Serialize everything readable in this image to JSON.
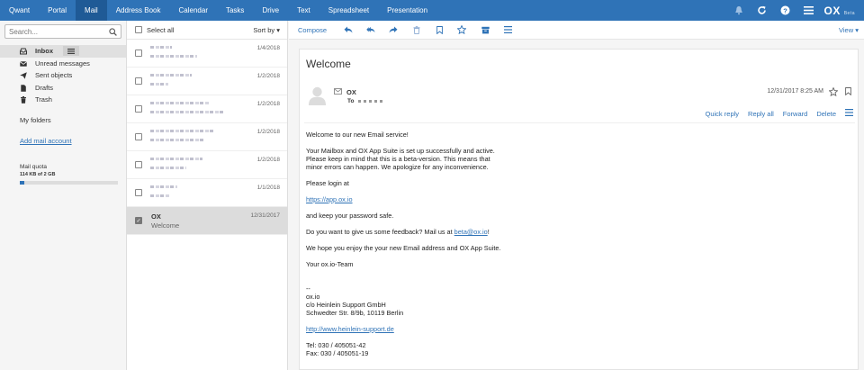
{
  "topnav": {
    "apps": [
      "Qwant",
      "Portal",
      "Mail",
      "Address Book",
      "Calendar",
      "Tasks",
      "Drive",
      "Text",
      "Spreadsheet",
      "Presentation"
    ],
    "active": "Mail",
    "logo_main": "OX",
    "logo_sub": "Beta"
  },
  "sidebar": {
    "search_placeholder": "Search...",
    "folders": [
      {
        "label": "Inbox",
        "icon": "inbox-icon"
      },
      {
        "label": "Unread messages",
        "icon": "envelope-icon"
      },
      {
        "label": "Sent objects",
        "icon": "paper-plane-icon"
      },
      {
        "label": "Drafts",
        "icon": "document-icon"
      },
      {
        "label": "Trash",
        "icon": "trash-icon"
      }
    ],
    "my_folders": "My folders",
    "add_mail_account": "Add mail account",
    "quota_label": "Mail quota",
    "quota_value": "114 KB of 2 GB",
    "quota_fraction": 0.05
  },
  "maillist": {
    "select_all": "Select all",
    "sort_by": "Sort by",
    "rows": [
      {
        "date": "1/4/2018"
      },
      {
        "date": "1/2/2018"
      },
      {
        "date": "1/2/2018"
      },
      {
        "date": "1/2/2018"
      },
      {
        "date": "1/2/2018"
      },
      {
        "date": "1/1/2018"
      }
    ],
    "selected": {
      "sender": "OX",
      "subject": "Welcome",
      "date": "12/31/2017"
    }
  },
  "toolbar": {
    "compose": "Compose",
    "view": "View"
  },
  "message": {
    "subject": "Welcome",
    "from": "OX",
    "to_label": "To",
    "date": "12/31/2017 8:25 AM",
    "actions": [
      "Quick reply",
      "Reply all",
      "Forward",
      "Delete"
    ],
    "body": {
      "p1": "Welcome to our new Email service!",
      "p2a": "Your Mailbox and OX App Suite is set up successfully and active.",
      "p2b": "Please keep in mind that this is a beta-version. This means that",
      "p2c": "minor errors can happen. We apologize for any inconvenience.",
      "p3": "Please login at",
      "link1": "https://app.ox.io",
      "p4": "and keep your password safe.",
      "p5_pre": "Do you want to give us some feedback? Mail us at ",
      "p5_link": "beta@ox.io",
      "p5_post": "!",
      "p6": "We hope you enjoy the your new Email address and OX App Suite.",
      "p7": "Your ox.io-Team",
      "sig_dash": "--",
      "sig1": "ox.io",
      "sig2": "c/o Heinlein Support GmbH",
      "sig3": "Schwedter Str. 8/9b, 10119 Berlin",
      "sig_link": "http://www.heinlein-support.de",
      "tel": "Tel: 030 / 405051-42",
      "fax": "Fax: 030 / 405051-19"
    }
  }
}
